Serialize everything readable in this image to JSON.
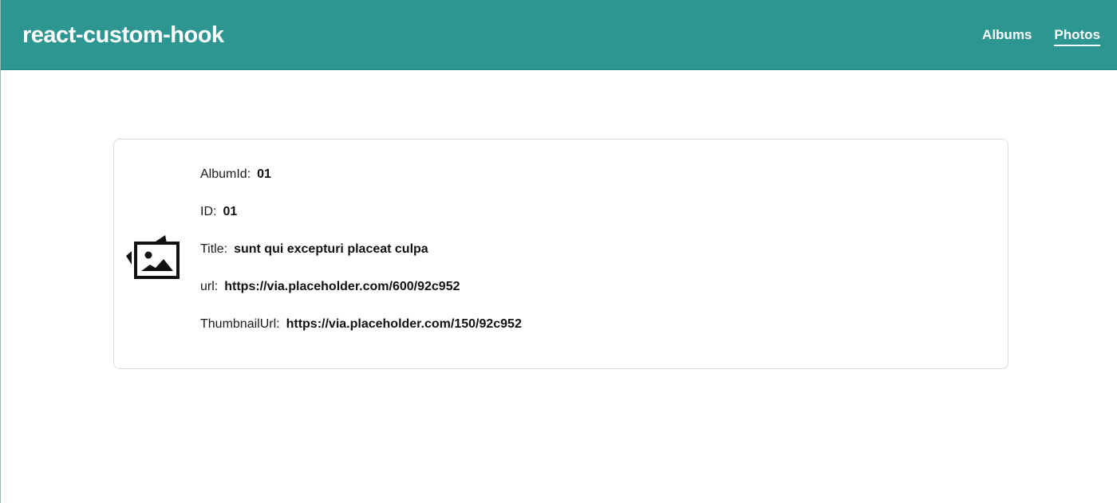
{
  "navbar": {
    "brand": "react-custom-hook",
    "links": [
      {
        "label": "Albums",
        "active": false
      },
      {
        "label": "Photos",
        "active": true
      }
    ],
    "background_color": "#2e9690"
  },
  "card": {
    "icon": "image-frame-icon",
    "fields": [
      {
        "label": "AlbumId:",
        "value": "01"
      },
      {
        "label": "ID:",
        "value": "01"
      },
      {
        "label": "Title:",
        "value": "sunt qui excepturi placeat culpa"
      },
      {
        "label": "url:",
        "value": "https://via.placeholder.com/600/92c952"
      },
      {
        "label": "ThumbnailUrl:",
        "value": "https://via.placeholder.com/150/92c952"
      }
    ]
  }
}
